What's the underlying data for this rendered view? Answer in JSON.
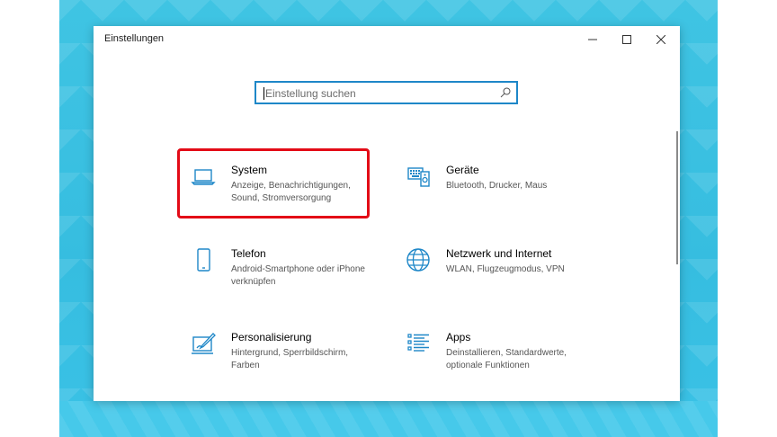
{
  "window": {
    "title": "Einstellungen",
    "controls": {
      "minimize": "minimize-icon",
      "maximize": "maximize-icon",
      "close": "close-icon"
    }
  },
  "search": {
    "placeholder": "Einstellung suchen",
    "icon": "search-icon"
  },
  "tiles": [
    {
      "title": "System",
      "description": "Anzeige, Benachrichtigungen, Sound, Stromversorgung",
      "icon": "laptop-icon",
      "highlighted": true
    },
    {
      "title": "Geräte",
      "description": "Bluetooth, Drucker, Maus",
      "icon": "devices-icon"
    },
    {
      "title": "Telefon",
      "description": "Android-Smartphone oder iPhone verknüpfen",
      "icon": "phone-icon"
    },
    {
      "title": "Netzwerk und Internet",
      "description": "WLAN, Flugzeugmodus, VPN",
      "icon": "globe-icon"
    },
    {
      "title": "Personalisierung",
      "description": "Hintergrund, Sperrbildschirm, Farben",
      "icon": "paint-icon"
    },
    {
      "title": "Apps",
      "description": "Deinstallieren, Standardwerte, optionale Funktionen",
      "icon": "apps-list-icon"
    }
  ],
  "colors": {
    "accent": "#1e87c8",
    "highlight": "#e30b17",
    "desktop": "#3fc4e3"
  }
}
